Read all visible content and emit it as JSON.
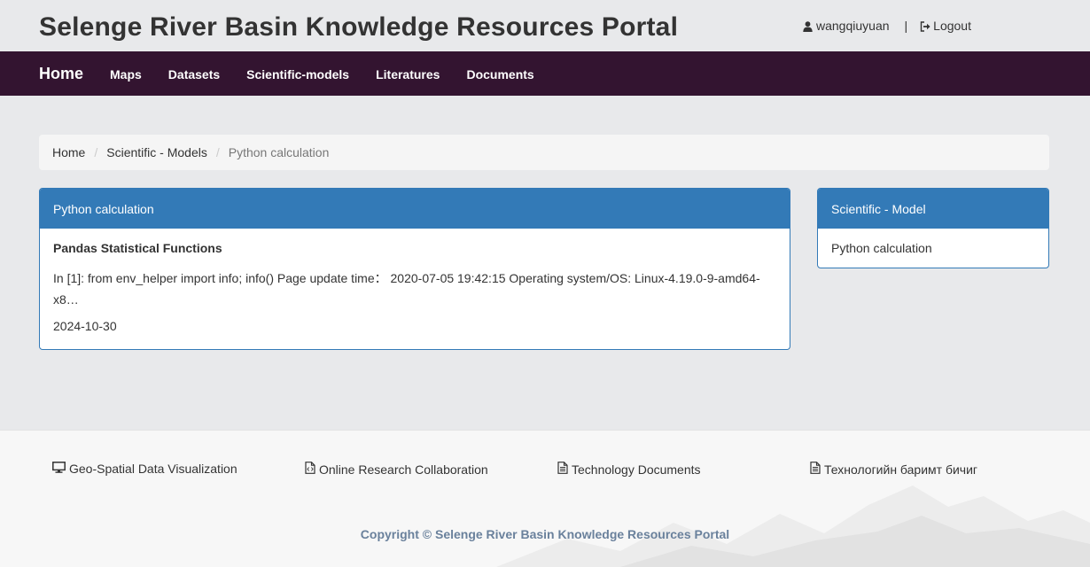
{
  "header": {
    "site_title": "Selenge River Basin Knowledge Resources Portal",
    "username": "wangqiuyuan",
    "separator": "|",
    "logout_label": "Logout",
    "user_icon": "user-icon",
    "logout_icon": "sign-out-icon"
  },
  "nav": {
    "home": "Home",
    "items": [
      "Maps",
      "Datasets",
      "Scientific-models",
      "Literatures",
      "Documents"
    ]
  },
  "breadcrumb": {
    "items": [
      "Home",
      "Scientific - Models"
    ],
    "separator": "/",
    "active": "Python calculation"
  },
  "main_panel": {
    "heading": "Python calculation",
    "item_title": "Pandas Statistical Functions",
    "item_description": "In [1]: from env_helper import info; info() Page update time： 2020-07-05 19:42:15 Operating system/OS: Linux-4.19.0-9-amd64-x8…",
    "item_date": "2024-10-30"
  },
  "side_panel": {
    "heading": "Scientific - Model",
    "link": "Python calculation"
  },
  "footer": {
    "links": [
      {
        "label": "Geo-Spatial Data Visualization",
        "icon": "desktop-icon"
      },
      {
        "label": "Online Research Collaboration",
        "icon": "file-code-icon"
      },
      {
        "label": "Technology Documents",
        "icon": "file-text-icon"
      },
      {
        "label": "Технологийн баримт бичиг",
        "icon": "file-text-icon"
      }
    ],
    "copyright": "Copyright © Selenge River Basin Knowledge Resources Portal"
  },
  "colors": {
    "navbar_bg": "#331430",
    "panel_primary": "#337ab7",
    "page_bg": "#e8e9eb",
    "copyright_text": "#6a819c"
  }
}
